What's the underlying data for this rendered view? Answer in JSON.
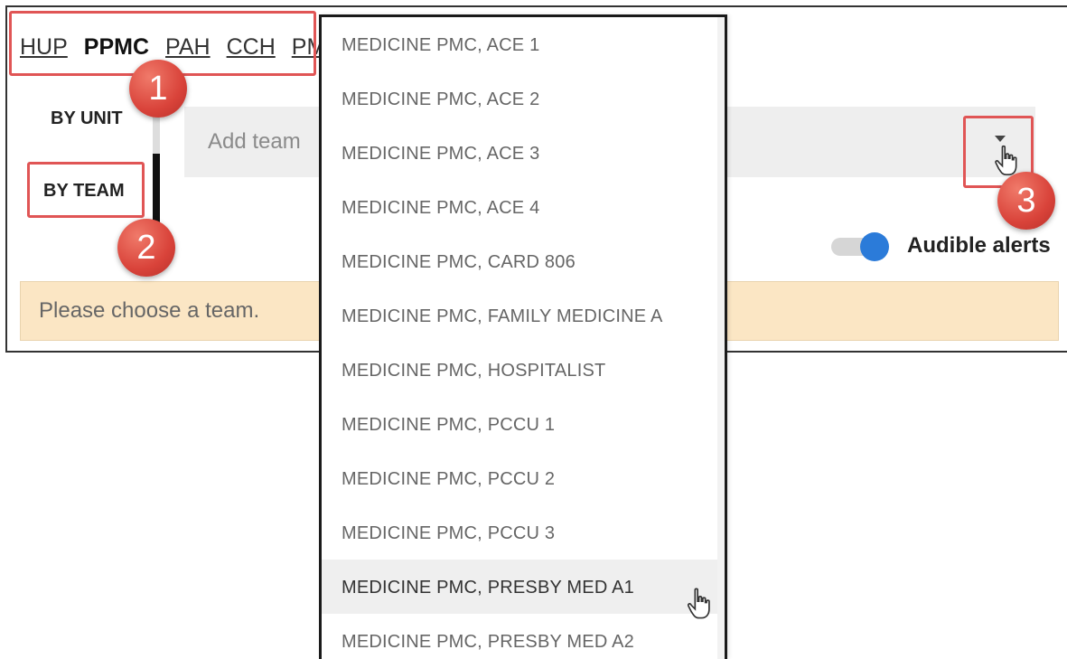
{
  "hospital_tabs": [
    {
      "label": "HUP",
      "active": false
    },
    {
      "label": "PPMC",
      "active": true
    },
    {
      "label": "PAH",
      "active": false
    },
    {
      "label": "CCH",
      "active": false
    },
    {
      "label": "PM",
      "active": false
    }
  ],
  "side_tabs": {
    "by_unit": "BY UNIT",
    "by_team": "BY TEAM",
    "selected": "BY TEAM"
  },
  "team_input": {
    "placeholder": "Add team",
    "value": ""
  },
  "audible_alerts": {
    "label": "Audible alerts",
    "enabled": true,
    "accent_color": "#2b7bd9"
  },
  "notice": {
    "text": "Please choose a team.",
    "background": "#fbe6c4"
  },
  "callouts": [
    "1",
    "2",
    "3"
  ],
  "callout_color": "#e05555",
  "team_options": [
    "MEDICINE PMC, ACE 1",
    "MEDICINE PMC, ACE 2",
    "MEDICINE PMC, ACE 3",
    "MEDICINE PMC, ACE 4",
    "MEDICINE PMC, CARD 806",
    "MEDICINE PMC, FAMILY MEDICINE A",
    "MEDICINE PMC, HOSPITALIST",
    "MEDICINE PMC, PCCU 1",
    "MEDICINE PMC, PCCU 2",
    "MEDICINE PMC, PCCU 3",
    "MEDICINE PMC, PRESBY MED A1",
    "MEDICINE PMC, PRESBY MED A2"
  ],
  "hovered_option": "MEDICINE PMC, PRESBY MED A1",
  "icons": {
    "dropdown": "caret-down-icon",
    "cursor": "hand-pointer-icon"
  }
}
